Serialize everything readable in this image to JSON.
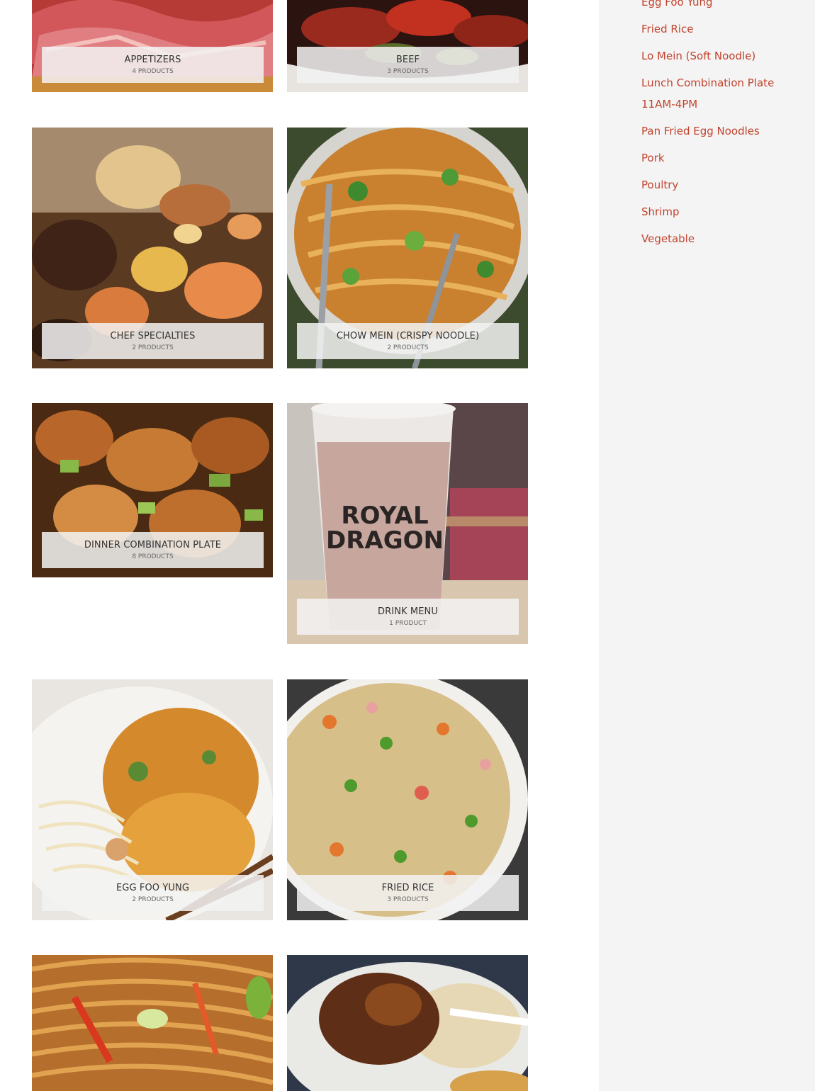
{
  "colors": {
    "link": "#c2432d",
    "sidebar_bg": "#f4f4f4",
    "label_bg": "#f2f2f2"
  },
  "categories": [
    {
      "name": "APPETIZERS",
      "count": "4 PRODUCTS",
      "photo": "char-siu-pork-icon"
    },
    {
      "name": "BEEF",
      "count": "3 PRODUCTS",
      "photo": "beef-stir-fry-icon"
    },
    {
      "name": "CHEF SPECIALTIES",
      "count": "2 PRODUCTS",
      "photo": "seafood-combo-icon"
    },
    {
      "name": "CHOW MEIN (CRISPY NOODLE)",
      "count": "2 PRODUCTS",
      "photo": "chow-mein-icon"
    },
    {
      "name": "DINNER COMBINATION PLATE",
      "count": "8 PRODUCTS",
      "photo": "general-chicken-icon"
    },
    {
      "name": "DRINK MENU",
      "count": "1 PRODUCT",
      "photo": "milk-tea-cup-icon",
      "cup_text": [
        "ROYAL",
        "DRAGON"
      ]
    },
    {
      "name": "EGG FOO YUNG",
      "count": "2 PRODUCTS",
      "photo": "egg-foo-yung-icon"
    },
    {
      "name": "FRIED RICE",
      "count": "3 PRODUCTS",
      "photo": "fried-rice-icon"
    },
    {
      "name": "",
      "count": "",
      "photo": "lo-mein-icon"
    },
    {
      "name": "",
      "count": "",
      "photo": "lunch-plate-icon"
    }
  ],
  "sidebar": {
    "links": [
      "Egg Foo Yung",
      "Fried Rice",
      "Lo Mein (Soft Noodle)",
      "Lunch Combination Plate 11AM-4PM",
      "Pan Fried Egg Noodles",
      "Pork",
      "Poultry",
      "Shrimp",
      "Vegetable"
    ]
  }
}
